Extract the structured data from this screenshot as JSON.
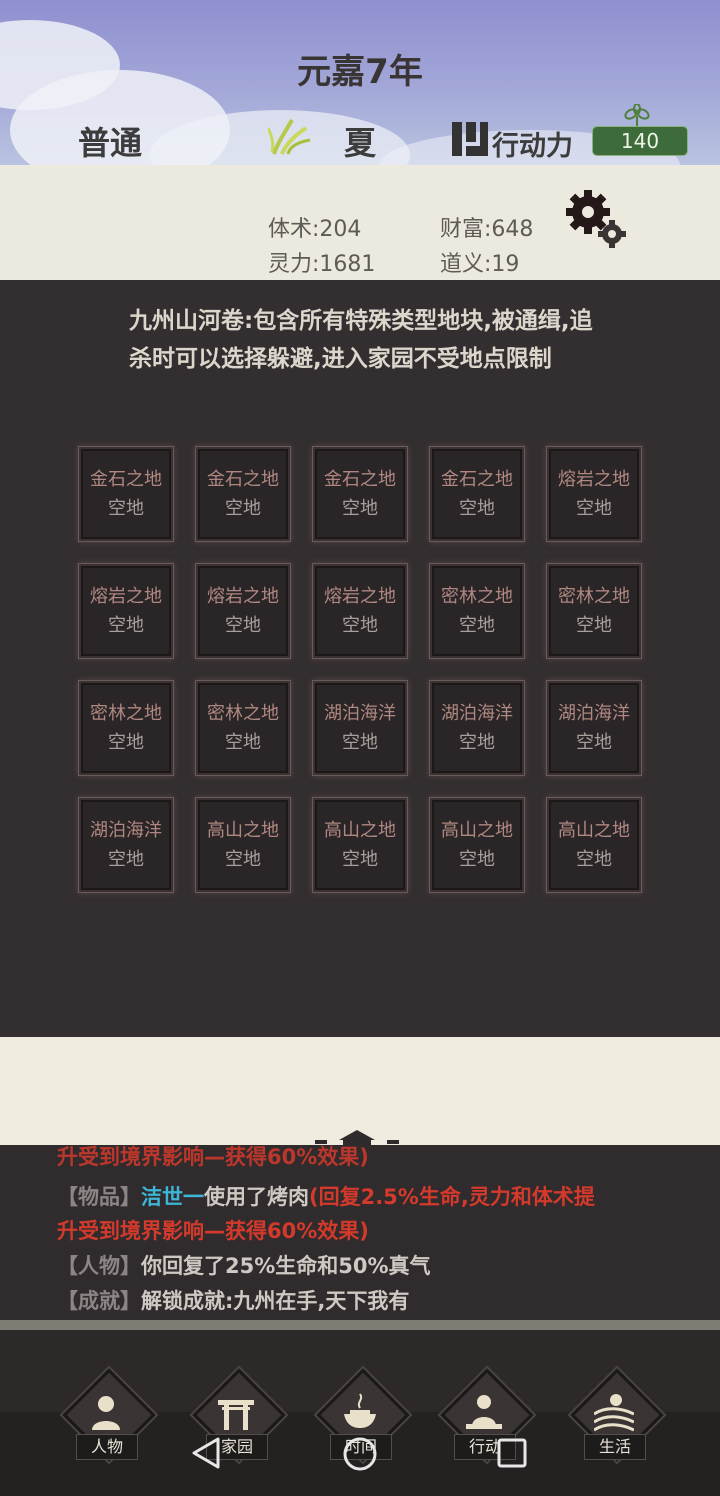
{
  "header": {
    "year": "元嘉7年",
    "difficulty": "普通",
    "season": "夏",
    "action_label": "行动力",
    "action_points": "140"
  },
  "stats": {
    "body": "体术:204",
    "wealth": "财富:648",
    "spirit": "灵力:1681",
    "virtue": "道义:19"
  },
  "item_description": "九州山河卷:包含所有特殊类型地块,被通缉,追杀时可以选择躲避,进入家园不受地点限制",
  "tiles": [
    {
      "type": "金石之地",
      "status": "空地"
    },
    {
      "type": "金石之地",
      "status": "空地"
    },
    {
      "type": "金石之地",
      "status": "空地"
    },
    {
      "type": "金石之地",
      "status": "空地"
    },
    {
      "type": "熔岩之地",
      "status": "空地"
    },
    {
      "type": "熔岩之地",
      "status": "空地"
    },
    {
      "type": "熔岩之地",
      "status": "空地"
    },
    {
      "type": "熔岩之地",
      "status": "空地"
    },
    {
      "type": "密林之地",
      "status": "空地"
    },
    {
      "type": "密林之地",
      "status": "空地"
    },
    {
      "type": "密林之地",
      "status": "空地"
    },
    {
      "type": "密林之地",
      "status": "空地"
    },
    {
      "type": "湖泊海洋",
      "status": "空地"
    },
    {
      "type": "湖泊海洋",
      "status": "空地"
    },
    {
      "type": "湖泊海洋",
      "status": "空地"
    },
    {
      "type": "湖泊海洋",
      "status": "空地"
    },
    {
      "type": "高山之地",
      "status": "空地"
    },
    {
      "type": "高山之地",
      "status": "空地"
    },
    {
      "type": "高山之地",
      "status": "空地"
    },
    {
      "type": "高山之地",
      "status": "空地"
    }
  ],
  "log": {
    "partial_line": "升受到境界影响—获得60%效果)",
    "line1_tag": "【物品】",
    "line1_name": "洁世一",
    "line1_text": "使用了烤肉",
    "line1_effect_a": "(回复2.5%生命,灵力和体术提",
    "line1_effect_b": "升受到境界影响—获得60%效果)",
    "line2_tag": "【人物】",
    "line2_text": "你回复了25%生命和50%真气",
    "line3_tag": "【成就】",
    "line3_text": "解锁成就:九州在手,天下我有"
  },
  "nav": [
    {
      "label": "人物",
      "icon": "person-icon"
    },
    {
      "label": "家园",
      "icon": "home-gate-icon"
    },
    {
      "label": "时间",
      "icon": "incense-burner-icon"
    },
    {
      "label": "行动",
      "icon": "meditate-icon"
    },
    {
      "label": "生活",
      "icon": "field-sun-icon"
    }
  ],
  "system_nav": [
    "back-icon",
    "home-icon",
    "recents-icon"
  ],
  "colors": {
    "panel": "#332e2f",
    "cream": "#efecdf",
    "log_red": "#d43a2c",
    "log_cyan": "#3eb6d8",
    "badge_green": "#3d6b3a"
  }
}
